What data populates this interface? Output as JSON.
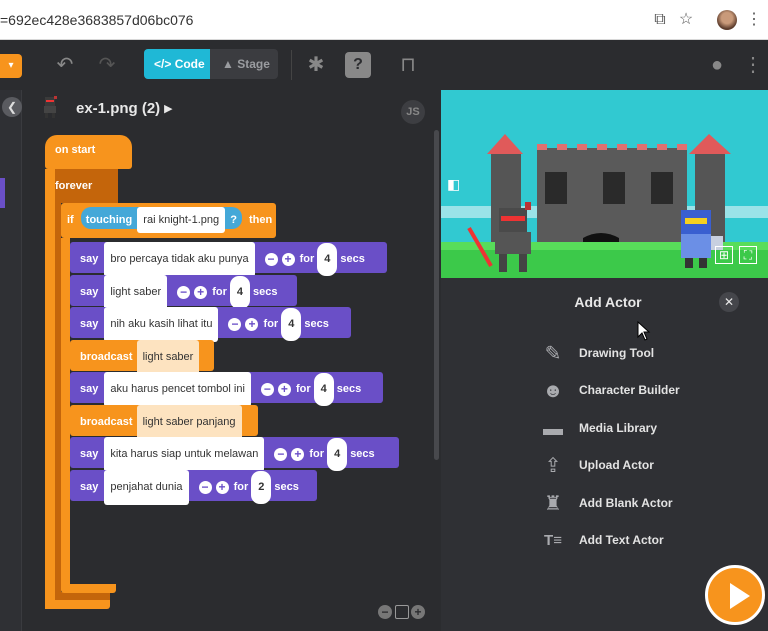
{
  "browser": {
    "url": "=692ec428e3683857d06bc076"
  },
  "topbar": {
    "code_label": "Code",
    "stage_label": "Stage"
  },
  "editor": {
    "file_name": "ex-1.png (2)",
    "js_label": "JS"
  },
  "blocks": {
    "on_start": "on start",
    "forever": "forever",
    "if_kw": "if",
    "touching_kw": "touching",
    "touching_target": "rai knight-1.png",
    "question": "?",
    "then_kw": "then",
    "say_kw": "say",
    "for_kw": "for",
    "secs_kw": "secs",
    "broadcast_kw": "broadcast",
    "statements": [
      {
        "type": "say",
        "text": "bro percaya tidak aku punya",
        "secs": "4"
      },
      {
        "type": "say",
        "text": "light saber",
        "secs": "4"
      },
      {
        "type": "say",
        "text": "nih aku kasih lihat itu",
        "secs": "4"
      },
      {
        "type": "broadcast",
        "text": "light saber"
      },
      {
        "type": "say",
        "text": "aku harus pencet tombol ini",
        "secs": "4"
      },
      {
        "type": "broadcast",
        "text": "light saber panjang"
      },
      {
        "type": "say",
        "text": "kita harus siap untuk melawan",
        "secs": "4"
      },
      {
        "type": "say",
        "text": "penjahat dunia",
        "secs": "2"
      }
    ]
  },
  "add_actor": {
    "title": "Add Actor",
    "items": [
      {
        "label": "Drawing Tool",
        "icon": "paint-bucket-icon"
      },
      {
        "label": "Character Builder",
        "icon": "smiley-face-icon"
      },
      {
        "label": "Media Library",
        "icon": "folder-icon"
      },
      {
        "label": "Upload Actor",
        "icon": "upload-icon"
      },
      {
        "label": "Add Blank Actor",
        "icon": "spy-icon"
      },
      {
        "label": "Add Text Actor",
        "icon": "text-actor-icon"
      }
    ]
  },
  "colors": {
    "accent_cyan": "#1fb8d6",
    "orange": "#f7941d",
    "purple": "#6a4fc7"
  }
}
